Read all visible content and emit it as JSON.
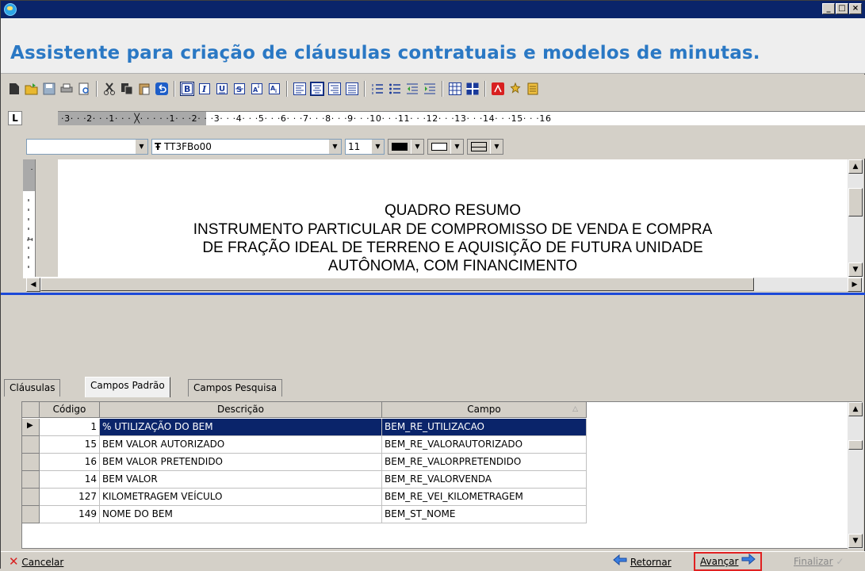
{
  "window": {
    "minimize": "_",
    "maximize": "□",
    "close": "×"
  },
  "heading": "Assistente para criação de cláusulas contratuais e modelos de minutas.",
  "ruler": {
    "corner": "L",
    "text": "·3· · ·2· · ·1· · · ╳· · · · ·1· · ·2· · ·3· · ·4· · ·5· · ·6· · ·7· · ·8· · ·9· · ·10· · ·11· · ·12· · ·13· · ·14· · ·15· · ·16"
  },
  "format": {
    "style_value": "",
    "font_value": "TT3FBo00",
    "font_prefix": "Ŧ",
    "size_value": "11"
  },
  "document": {
    "lines": [
      "QUADRO RESUMO",
      "INSTRUMENTO PARTICULAR DE COMPROMISSO DE VENDA E COMPRA",
      "DE FRAÇÃO IDEAL DE TERRENO E AQUISIÇÃO DE FUTURA UNIDADE",
      "AUTÔNOMA, COM FINANCIMENTO"
    ]
  },
  "tabs": [
    {
      "label": "Cláusulas",
      "active": false
    },
    {
      "label": "Campos Padrão",
      "active": true
    },
    {
      "label": "Campos Pesquisa",
      "active": false
    }
  ],
  "grid": {
    "headers": [
      "Código",
      "Descrição",
      "Campo"
    ],
    "rows": [
      {
        "codigo": "1",
        "descricao": "% UTILIZAÇÃO DO BEM",
        "campo": "BEM_RE_UTILIZACAO",
        "selected": true
      },
      {
        "codigo": "15",
        "descricao": "BEM VALOR AUTORIZADO",
        "campo": "BEM_RE_VALORAUTORIZADO",
        "selected": false
      },
      {
        "codigo": "16",
        "descricao": "BEM VALOR PRETENDIDO",
        "campo": "BEM_RE_VALORPRETENDIDO",
        "selected": false
      },
      {
        "codigo": "14",
        "descricao": "BEM VALOR",
        "campo": "BEM_RE_VALORVENDA",
        "selected": false
      },
      {
        "codigo": "127",
        "descricao": "KILOMETRAGEM VEÍCULO",
        "campo": "BEM_RE_VEI_KILOMETRAGEM",
        "selected": false
      },
      {
        "codigo": "149",
        "descricao": "NOME DO BEM",
        "campo": "BEM_ST_NOME",
        "selected": false
      }
    ]
  },
  "footer": {
    "cancelar": "Cancelar",
    "retornar": "Retornar",
    "avancar": "Avançar",
    "finalizar": "Finalizar"
  },
  "colors": {
    "heading": "#2a78c4",
    "titlebar": "#0a246a",
    "selection": "#0a246a",
    "highlight_border": "#e02020",
    "separator_line": "#1c49d8"
  }
}
